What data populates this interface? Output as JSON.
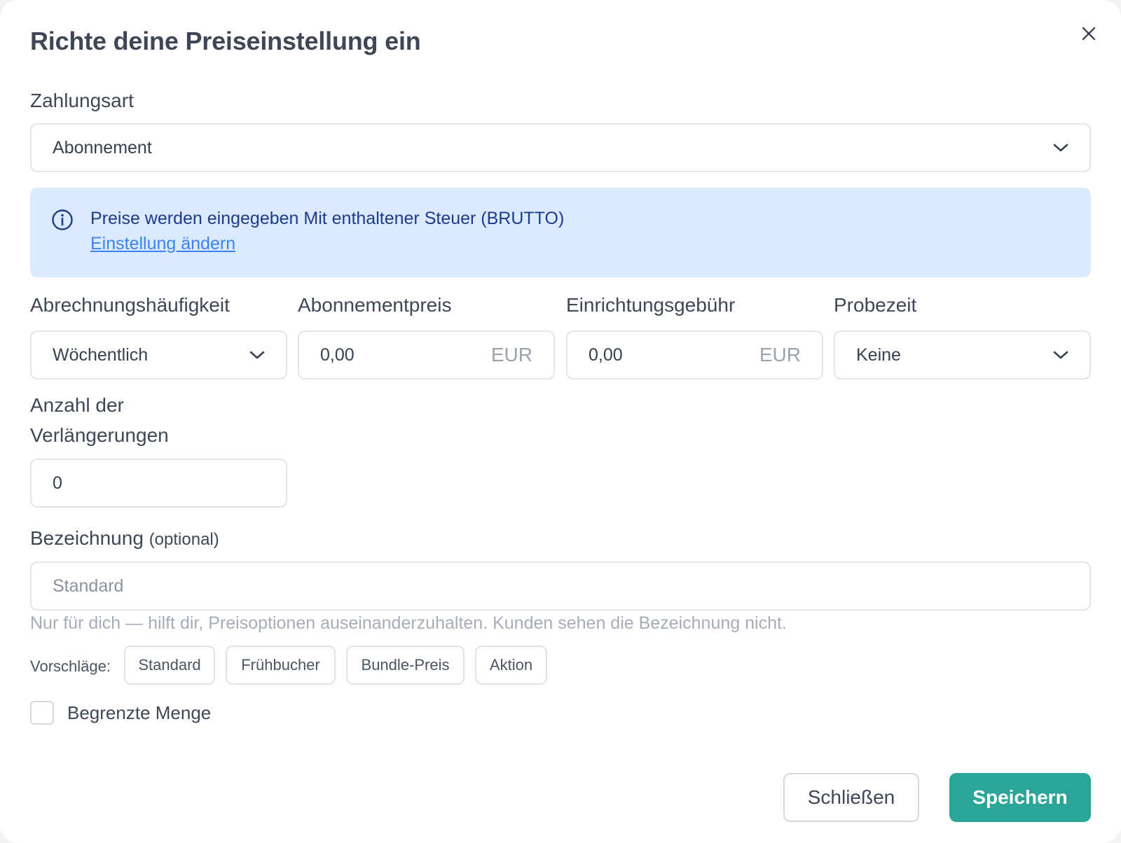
{
  "dialog": {
    "title": "Richte deine Preiseinstellung ein",
    "close_icon": "close-icon"
  },
  "payment_type": {
    "label": "Zahlungsart",
    "value": "Abonnement"
  },
  "info": {
    "icon": "info-icon",
    "message": "Preise werden eingegeben Mit enthaltener Steuer (BRUTTO)",
    "link": "Einstellung ändern"
  },
  "billing_frequency": {
    "label": "Abrechnungshäufigkeit",
    "value": "Wöchentlich"
  },
  "subscription_price": {
    "label": "Abonnementpreis",
    "value": "0,00",
    "currency": "EUR"
  },
  "setup_fee": {
    "label": "Einrichtungsgebühr",
    "value": "0,00",
    "currency": "EUR"
  },
  "trial": {
    "label": "Probezeit",
    "value": "Keine"
  },
  "renewals": {
    "label_line1": "Anzahl der",
    "label_line2": "Verlängerungen",
    "value": "0"
  },
  "name": {
    "label": "Bezeichnung",
    "optional": "(optional)",
    "placeholder": "Standard",
    "help": "Nur für dich — hilft dir, Preisoptionen auseinanderzuhalten. Kunden sehen die Bezeichnung nicht."
  },
  "suggestions": {
    "label": "Vorschläge:",
    "items": [
      "Standard",
      "Frühbucher",
      "Bundle-Preis",
      "Aktion"
    ]
  },
  "limited": {
    "label": "Begrenzte Menge",
    "checked": false
  },
  "footer": {
    "close_label": "Schließen",
    "save_label": "Speichern"
  },
  "colors": {
    "accent": "#2aa597",
    "info_bg": "#dbeafe",
    "info_text": "#1e3a8a",
    "link": "#3b82f6"
  }
}
